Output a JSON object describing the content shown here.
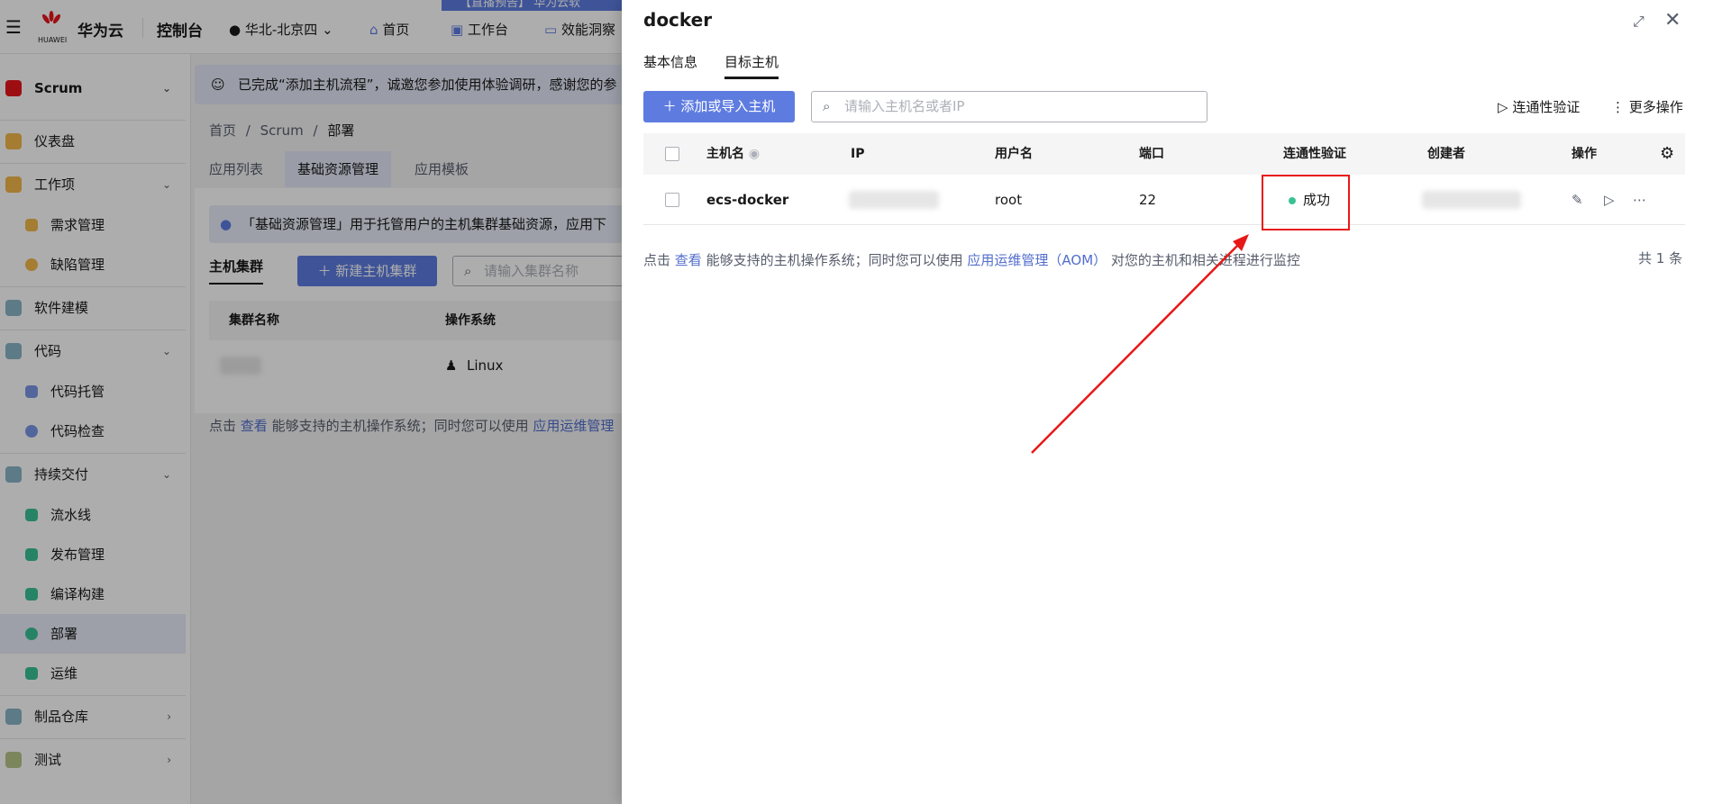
{
  "topbar": {
    "brand": "华为云",
    "brand_sub": "HUAWEI",
    "console": "控制台",
    "region": "华北-北京四",
    "nav": [
      "首页",
      "工作台",
      "效能洞察"
    ],
    "banner": "【直播预告】 华为云软"
  },
  "sidebar": {
    "project": "Scrum",
    "items": [
      {
        "label": "仪表盘"
      },
      {
        "label": "工作项"
      },
      {
        "label": "需求管理"
      },
      {
        "label": "缺陷管理"
      },
      {
        "label": "软件建模"
      },
      {
        "label": "代码"
      },
      {
        "label": "代码托管"
      },
      {
        "label": "代码检查"
      },
      {
        "label": "持续交付"
      },
      {
        "label": "流水线"
      },
      {
        "label": "发布管理"
      },
      {
        "label": "编译构建"
      },
      {
        "label": "部署"
      },
      {
        "label": "运维"
      },
      {
        "label": "制品仓库"
      },
      {
        "label": "测试"
      }
    ]
  },
  "main": {
    "notice": "已完成“添加主机流程”，诚邀您参加使用体验调研，感谢您的参",
    "breadcrumb": [
      "首页",
      "Scrum",
      "部署"
    ],
    "breadcrumb_sep": "/",
    "tabs": [
      "应用列表",
      "基础资源管理",
      "应用模板"
    ],
    "info": "「基础资源管理」用于托管用户的主机集群基础资源，应用下",
    "cluster_tab": "主机集群",
    "new_cluster_button": "新建主机集群",
    "cluster_search_placeholder": "请输入集群名称",
    "cluster_columns": [
      "集群名称",
      "操作系统"
    ],
    "cluster_row_os": "Linux",
    "note_prefix": "点击",
    "note_link": "查看",
    "note_mid": "能够支持的主机操作系统；同时您可以使用",
    "note_link2": "应用运维管理"
  },
  "drawer": {
    "title": "docker",
    "tabs": [
      "基本信息",
      "目标主机"
    ],
    "add_button": "添加或导入主机",
    "search_placeholder": "请输入主机名或者IP",
    "conn_button": "连通性验证",
    "more_button": "更多操作",
    "columns": [
      "主机名",
      "IP",
      "用户名",
      "端口",
      "连通性验证",
      "创建者",
      "操作"
    ],
    "row": {
      "hostname": "ecs-docker",
      "username": "root",
      "port": "22",
      "status": "成功"
    },
    "note": {
      "prefix": "点击",
      "link1": "查看",
      "mid": "能够支持的主机操作系统；同时您可以使用",
      "link2": "应用运维管理（AOM）",
      "suffix": "对您的主机和相关进程进行监控"
    },
    "total": "共 1 条"
  },
  "colors": {
    "accent": "#5e7ce0",
    "success": "#3ac295",
    "highlight": "#e81818"
  }
}
